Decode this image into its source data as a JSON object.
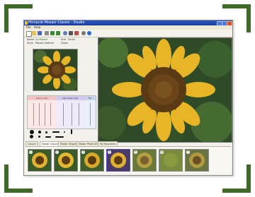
{
  "window": {
    "title": "Pinnacle Mosaic Classic - Studio",
    "buttons": [
      "minimize",
      "maximize",
      "close"
    ]
  },
  "menu": {
    "items": [
      "File",
      "Help"
    ]
  },
  "toolbar": {
    "icons": [
      "new-icon",
      "open-icon",
      "save-icon",
      "print-icon",
      "undo-icon",
      "redo-icon",
      "zoom-icon",
      "crop-icon",
      "paint-icon",
      "settings-icon",
      "help-icon"
    ]
  },
  "info": {
    "name_label": "Name",
    "name_value": "Sunflower",
    "size_label": "Size",
    "size_value": "Small",
    "style_label": "Style",
    "style_value": "Mosaic Natural",
    "zoom_label": "Zoom",
    "zoom_value": ""
  },
  "mixer": {
    "col1": "Colour (All)",
    "col2": "Saturation (All)",
    "col3": "Tile"
  },
  "tabs": [
    "Colours",
    "Mosaic Colours",
    "Mosaic Shapes",
    "Mosaic Photo Art",
    "My Favourites"
  ],
  "active_tab": 1,
  "thumbnails": [
    {
      "n": "1"
    },
    {
      "n": "2"
    },
    {
      "n": "3"
    },
    {
      "n": "4"
    },
    {
      "n": "5"
    },
    {
      "n": "6"
    },
    {
      "n": "7"
    }
  ],
  "colors": {
    "frame": "#3f6a2a",
    "titlebar": "#2b58c8",
    "petal": "#e8b526",
    "center": "#5a3a14",
    "leaf": "#3e6a2e"
  }
}
